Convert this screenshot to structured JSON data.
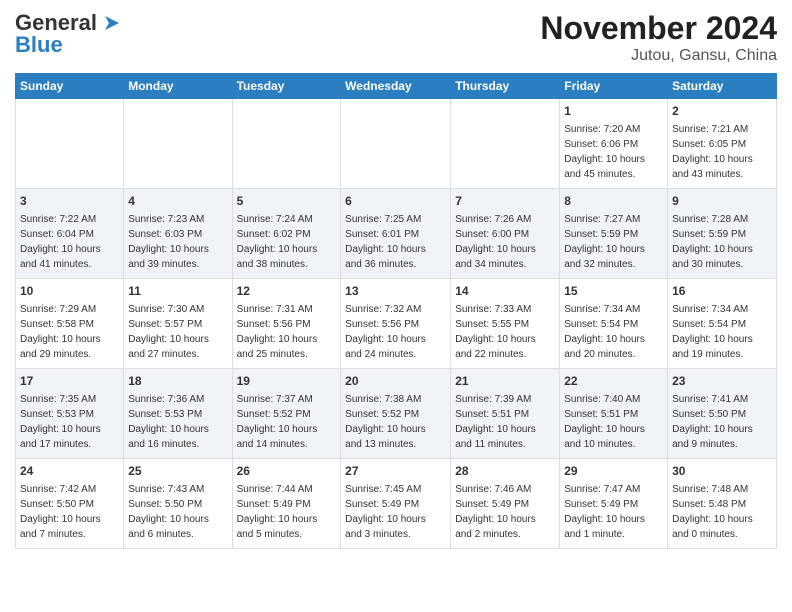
{
  "header": {
    "logo_line1": "General",
    "logo_line2": "Blue",
    "title": "November 2024",
    "subtitle": "Jutou, Gansu, China"
  },
  "columns": [
    "Sunday",
    "Monday",
    "Tuesday",
    "Wednesday",
    "Thursday",
    "Friday",
    "Saturday"
  ],
  "weeks": [
    [
      {
        "day": "",
        "info": ""
      },
      {
        "day": "",
        "info": ""
      },
      {
        "day": "",
        "info": ""
      },
      {
        "day": "",
        "info": ""
      },
      {
        "day": "",
        "info": ""
      },
      {
        "day": "1",
        "info": "Sunrise: 7:20 AM\nSunset: 6:06 PM\nDaylight: 10 hours\nand 45 minutes."
      },
      {
        "day": "2",
        "info": "Sunrise: 7:21 AM\nSunset: 6:05 PM\nDaylight: 10 hours\nand 43 minutes."
      }
    ],
    [
      {
        "day": "3",
        "info": "Sunrise: 7:22 AM\nSunset: 6:04 PM\nDaylight: 10 hours\nand 41 minutes."
      },
      {
        "day": "4",
        "info": "Sunrise: 7:23 AM\nSunset: 6:03 PM\nDaylight: 10 hours\nand 39 minutes."
      },
      {
        "day": "5",
        "info": "Sunrise: 7:24 AM\nSunset: 6:02 PM\nDaylight: 10 hours\nand 38 minutes."
      },
      {
        "day": "6",
        "info": "Sunrise: 7:25 AM\nSunset: 6:01 PM\nDaylight: 10 hours\nand 36 minutes."
      },
      {
        "day": "7",
        "info": "Sunrise: 7:26 AM\nSunset: 6:00 PM\nDaylight: 10 hours\nand 34 minutes."
      },
      {
        "day": "8",
        "info": "Sunrise: 7:27 AM\nSunset: 5:59 PM\nDaylight: 10 hours\nand 32 minutes."
      },
      {
        "day": "9",
        "info": "Sunrise: 7:28 AM\nSunset: 5:59 PM\nDaylight: 10 hours\nand 30 minutes."
      }
    ],
    [
      {
        "day": "10",
        "info": "Sunrise: 7:29 AM\nSunset: 5:58 PM\nDaylight: 10 hours\nand 29 minutes."
      },
      {
        "day": "11",
        "info": "Sunrise: 7:30 AM\nSunset: 5:57 PM\nDaylight: 10 hours\nand 27 minutes."
      },
      {
        "day": "12",
        "info": "Sunrise: 7:31 AM\nSunset: 5:56 PM\nDaylight: 10 hours\nand 25 minutes."
      },
      {
        "day": "13",
        "info": "Sunrise: 7:32 AM\nSunset: 5:56 PM\nDaylight: 10 hours\nand 24 minutes."
      },
      {
        "day": "14",
        "info": "Sunrise: 7:33 AM\nSunset: 5:55 PM\nDaylight: 10 hours\nand 22 minutes."
      },
      {
        "day": "15",
        "info": "Sunrise: 7:34 AM\nSunset: 5:54 PM\nDaylight: 10 hours\nand 20 minutes."
      },
      {
        "day": "16",
        "info": "Sunrise: 7:34 AM\nSunset: 5:54 PM\nDaylight: 10 hours\nand 19 minutes."
      }
    ],
    [
      {
        "day": "17",
        "info": "Sunrise: 7:35 AM\nSunset: 5:53 PM\nDaylight: 10 hours\nand 17 minutes."
      },
      {
        "day": "18",
        "info": "Sunrise: 7:36 AM\nSunset: 5:53 PM\nDaylight: 10 hours\nand 16 minutes."
      },
      {
        "day": "19",
        "info": "Sunrise: 7:37 AM\nSunset: 5:52 PM\nDaylight: 10 hours\nand 14 minutes."
      },
      {
        "day": "20",
        "info": "Sunrise: 7:38 AM\nSunset: 5:52 PM\nDaylight: 10 hours\nand 13 minutes."
      },
      {
        "day": "21",
        "info": "Sunrise: 7:39 AM\nSunset: 5:51 PM\nDaylight: 10 hours\nand 11 minutes."
      },
      {
        "day": "22",
        "info": "Sunrise: 7:40 AM\nSunset: 5:51 PM\nDaylight: 10 hours\nand 10 minutes."
      },
      {
        "day": "23",
        "info": "Sunrise: 7:41 AM\nSunset: 5:50 PM\nDaylight: 10 hours\nand 9 minutes."
      }
    ],
    [
      {
        "day": "24",
        "info": "Sunrise: 7:42 AM\nSunset: 5:50 PM\nDaylight: 10 hours\nand 7 minutes."
      },
      {
        "day": "25",
        "info": "Sunrise: 7:43 AM\nSunset: 5:50 PM\nDaylight: 10 hours\nand 6 minutes."
      },
      {
        "day": "26",
        "info": "Sunrise: 7:44 AM\nSunset: 5:49 PM\nDaylight: 10 hours\nand 5 minutes."
      },
      {
        "day": "27",
        "info": "Sunrise: 7:45 AM\nSunset: 5:49 PM\nDaylight: 10 hours\nand 3 minutes."
      },
      {
        "day": "28",
        "info": "Sunrise: 7:46 AM\nSunset: 5:49 PM\nDaylight: 10 hours\nand 2 minutes."
      },
      {
        "day": "29",
        "info": "Sunrise: 7:47 AM\nSunset: 5:49 PM\nDaylight: 10 hours\nand 1 minute."
      },
      {
        "day": "30",
        "info": "Sunrise: 7:48 AM\nSunset: 5:48 PM\nDaylight: 10 hours\nand 0 minutes."
      }
    ]
  ]
}
